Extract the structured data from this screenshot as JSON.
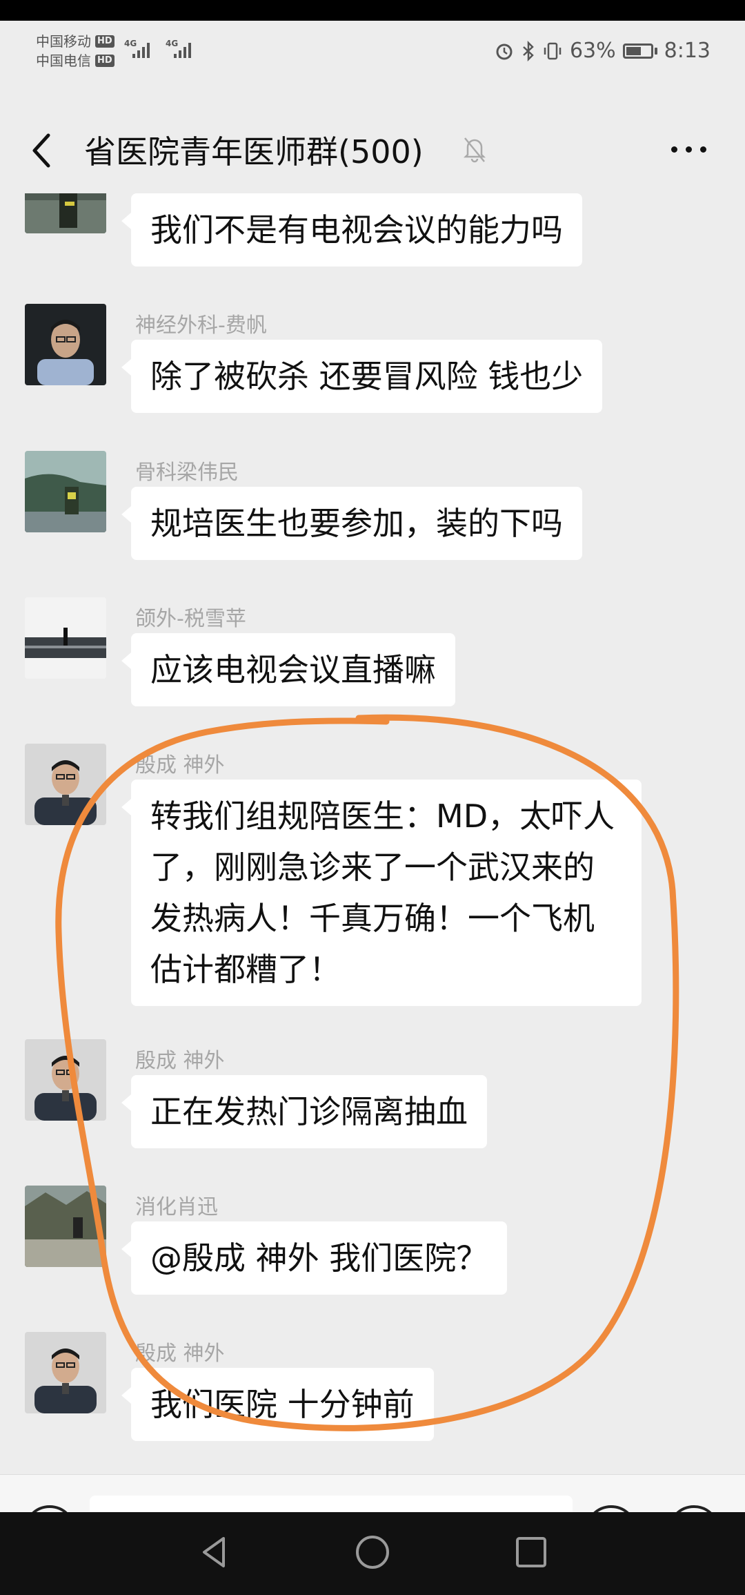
{
  "status_bar": {
    "carrier1": "中国移动",
    "carrier2": "中国电信",
    "hd_badge": "HD",
    "network": "4G",
    "battery": "63%",
    "battery_level": 0.63,
    "time": "8:13"
  },
  "header": {
    "title": "省医院青年医师群(500)"
  },
  "messages": [
    {
      "sender": "",
      "text": "我们不是有电视会议的能力吗"
    },
    {
      "sender": "神经外科-费帆",
      "text": "除了被砍杀 还要冒风险 钱也少"
    },
    {
      "sender": "骨科梁伟民",
      "text": "规培医生也要参加，装的下吗"
    },
    {
      "sender": "颌外-税雪苹",
      "text": "应该电视会议直播嘛"
    },
    {
      "sender": "殷成 神外",
      "text": "转我们组规陪医生：MD，太吓人了，刚刚急诊来了一个武汉来的发热病人！千真万确！一个飞机估计都糟了！"
    },
    {
      "sender": "殷成 神外",
      "text": "正在发热门诊隔离抽血"
    },
    {
      "sender": "消化肖迅",
      "text": "@殷成 神外  我们医院？"
    },
    {
      "sender": "殷成 神外",
      "text": "我们医院 十分钟前"
    }
  ],
  "colors": {
    "annotation": "#ef8a3c",
    "bubble": "#ffffff",
    "chat_bg": "#ededed"
  }
}
